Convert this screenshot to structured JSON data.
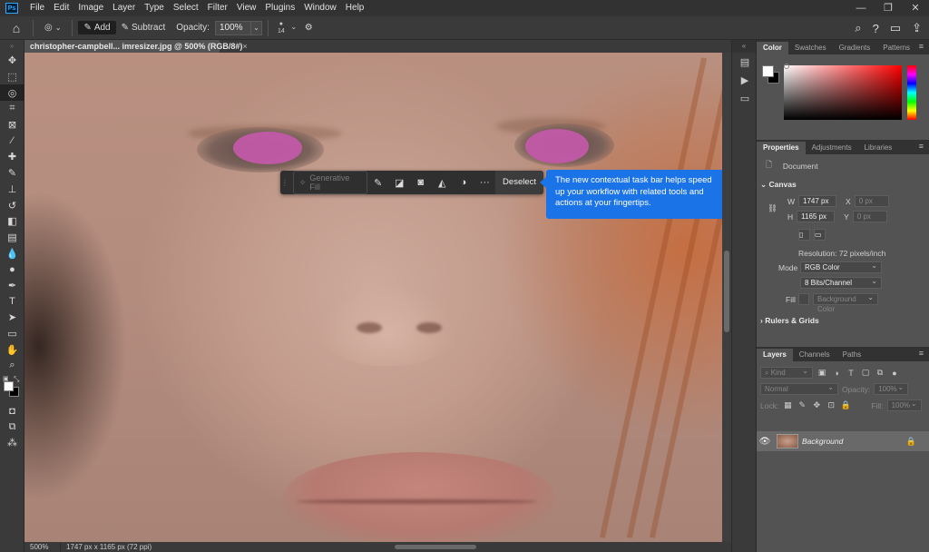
{
  "menubar": {
    "app_logo": "Ps",
    "items": [
      "File",
      "Edit",
      "Image",
      "Layer",
      "Type",
      "Select",
      "Filter",
      "View",
      "Plugins",
      "Window",
      "Help"
    ],
    "window_controls": [
      "—",
      "❐",
      "✕"
    ]
  },
  "options": {
    "add_label": "Add",
    "subtract_label": "Subtract",
    "opacity_label": "Opacity:",
    "opacity_value": "100%",
    "brush_size": "14"
  },
  "document": {
    "tab_title": "christopher-campbell... imresizer.jpg @ 500% (RGB/8#)",
    "close": "×"
  },
  "taskbar": {
    "generative_fill": "Generative Fill",
    "more": "···",
    "deselect": "Deselect"
  },
  "tip": {
    "text": "The new contextual task bar helps speed up your workflow with related tools and actions at your fingertips."
  },
  "status": {
    "zoom": "500%",
    "info": "1747 px x 1165 px (72 ppi)"
  },
  "color_panel": {
    "tabs": [
      "Color",
      "Swatches",
      "Gradients",
      "Patterns"
    ]
  },
  "properties_panel": {
    "tabs": [
      "Properties",
      "Adjustments",
      "Libraries"
    ],
    "document_label": "Document",
    "canvas_heading": "Canvas",
    "w_label": "W",
    "w_value": "1747 px",
    "x_label": "X",
    "x_value": "0 px",
    "h_label": "H",
    "h_value": "1165 px",
    "y_label": "Y",
    "y_value": "0 px",
    "resolution": "Resolution: 72 pixels/inch",
    "mode_label": "Mode",
    "mode_value": "RGB Color",
    "bits_value": "8 Bits/Channel",
    "fill_label": "Fill",
    "fill_value": "Background Color",
    "rulers_heading": "Rulers & Grids"
  },
  "layers_panel": {
    "tabs": [
      "Layers",
      "Channels",
      "Paths"
    ],
    "kind_filter": "Kind",
    "blend_mode": "Normal",
    "opacity_label": "Opacity:",
    "opacity_value": "100%",
    "lock_label": "Lock:",
    "fill_label": "Fill:",
    "fill_value": "100%",
    "layer_name": "Background"
  }
}
